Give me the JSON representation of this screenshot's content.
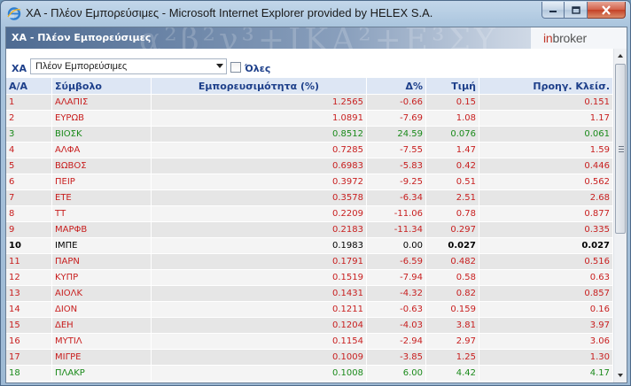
{
  "window": {
    "title": "ΧΑ - Πλέον Εμπορεύσιμες - Microsoft Internet Explorer provided by HELEX S.A."
  },
  "banner": {
    "title": "ΧΑ - Πλέον Εμπορεύσιμες",
    "logo_in": "in",
    "logo_broker": "broker"
  },
  "filter": {
    "label": "ΧΑ",
    "select_value": "Πλέον Εμπορεύσιμες",
    "checkbox_label": "Όλες"
  },
  "table": {
    "headers": [
      "Α/Α",
      "Σύμβολο",
      "Εμπορευσιμότητα (%)",
      "Δ%",
      "Τιμή",
      "Προηγ. Κλείσ."
    ],
    "rows": [
      {
        "n": "1",
        "sym": "ΑΛΑΠΙΣ",
        "trad": "1.2565",
        "chg": "-0.66",
        "price": "0.15",
        "prev": "0.151",
        "dir": "dn"
      },
      {
        "n": "2",
        "sym": "ΕΥΡΩΒ",
        "trad": "1.0891",
        "chg": "-7.69",
        "price": "1.08",
        "prev": "1.17",
        "dir": "dn"
      },
      {
        "n": "3",
        "sym": "ΒΙΟΣΚ",
        "trad": "0.8512",
        "chg": "24.59",
        "price": "0.076",
        "prev": "0.061",
        "dir": "up"
      },
      {
        "n": "4",
        "sym": "ΑΛΦΑ",
        "trad": "0.7285",
        "chg": "-7.55",
        "price": "1.47",
        "prev": "1.59",
        "dir": "dn"
      },
      {
        "n": "5",
        "sym": "ΒΩΒΟΣ",
        "trad": "0.6983",
        "chg": "-5.83",
        "price": "0.42",
        "prev": "0.446",
        "dir": "dn"
      },
      {
        "n": "6",
        "sym": "ΠΕΙΡ",
        "trad": "0.3972",
        "chg": "-9.25",
        "price": "0.51",
        "prev": "0.562",
        "dir": "dn"
      },
      {
        "n": "7",
        "sym": "ΕΤΕ",
        "trad": "0.3578",
        "chg": "-6.34",
        "price": "2.51",
        "prev": "2.68",
        "dir": "dn"
      },
      {
        "n": "8",
        "sym": "ΤΤ",
        "trad": "0.2209",
        "chg": "-11.06",
        "price": "0.78",
        "prev": "0.877",
        "dir": "dn"
      },
      {
        "n": "9",
        "sym": "ΜΑΡΦΒ",
        "trad": "0.2183",
        "chg": "-11.34",
        "price": "0.297",
        "prev": "0.335",
        "dir": "dn"
      },
      {
        "n": "10",
        "sym": "ΙΜΠΕ",
        "trad": "0.1983",
        "chg": "0.00",
        "price": "0.027",
        "prev": "0.027",
        "dir": "eq"
      },
      {
        "n": "11",
        "sym": "ΠΑΡΝ",
        "trad": "0.1791",
        "chg": "-6.59",
        "price": "0.482",
        "prev": "0.516",
        "dir": "dn"
      },
      {
        "n": "12",
        "sym": "ΚΥΠΡ",
        "trad": "0.1519",
        "chg": "-7.94",
        "price": "0.58",
        "prev": "0.63",
        "dir": "dn"
      },
      {
        "n": "13",
        "sym": "ΑΙΟΛΚ",
        "trad": "0.1431",
        "chg": "-4.32",
        "price": "0.82",
        "prev": "0.857",
        "dir": "dn"
      },
      {
        "n": "14",
        "sym": "ΔΙΟΝ",
        "trad": "0.1211",
        "chg": "-0.63",
        "price": "0.159",
        "prev": "0.16",
        "dir": "dn"
      },
      {
        "n": "15",
        "sym": "ΔΕΗ",
        "trad": "0.1204",
        "chg": "-4.03",
        "price": "3.81",
        "prev": "3.97",
        "dir": "dn"
      },
      {
        "n": "16",
        "sym": "ΜΥΤΙΛ",
        "trad": "0.1154",
        "chg": "-2.94",
        "price": "2.97",
        "prev": "3.06",
        "dir": "dn"
      },
      {
        "n": "17",
        "sym": "ΜΙΓΡΕ",
        "trad": "0.1009",
        "chg": "-3.85",
        "price": "1.25",
        "prev": "1.30",
        "dir": "dn"
      },
      {
        "n": "18",
        "sym": "ΠΛΑΚΡ",
        "trad": "0.1008",
        "chg": "6.00",
        "price": "4.42",
        "prev": "4.17",
        "dir": "up"
      }
    ]
  },
  "colors": {
    "down": "#c81e1e",
    "up": "#1a8a1a",
    "unchanged": "#000000",
    "header_text": "#1d3f8a"
  }
}
